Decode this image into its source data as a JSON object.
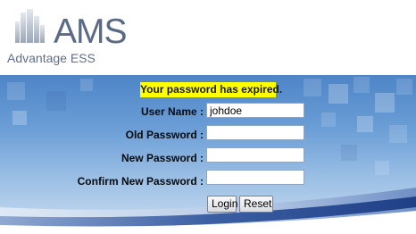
{
  "logo": {
    "title": "AMS",
    "subtitle": "Advantage ESS",
    "icon": "city-buildings-icon"
  },
  "form": {
    "message": "Your password has expired.",
    "fields": {
      "username": {
        "label": "User Name :",
        "value": "johdoe"
      },
      "old_password": {
        "label": "Old Password :",
        "value": ""
      },
      "new_password": {
        "label": "New Password :",
        "value": ""
      },
      "confirm_password": {
        "label": "Confirm New Password :",
        "value": ""
      }
    },
    "buttons": {
      "login": "Login",
      "reset": "Reset"
    }
  },
  "colors": {
    "message_bg": "#ffff00",
    "banner_top": "#4e85c7",
    "banner_bottom": "#c7dbef",
    "swoosh": "#2b4f93"
  }
}
